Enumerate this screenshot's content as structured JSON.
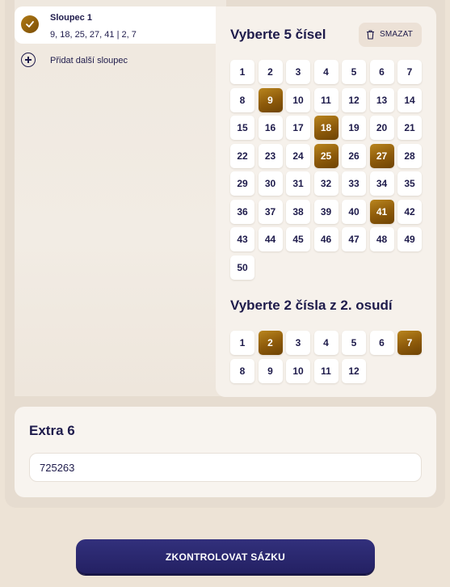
{
  "column": {
    "title": "Sloupec 1",
    "numbers": "9, 18, 25, 27, 41 | 2, 7"
  },
  "add_column_label": "Přidat další sloupec",
  "main_section": {
    "title": "Vyberte 5 čísel",
    "clear_label": "SMAZAT",
    "numbers": [
      1,
      2,
      3,
      4,
      5,
      6,
      7,
      8,
      9,
      10,
      11,
      12,
      13,
      14,
      15,
      16,
      17,
      18,
      19,
      20,
      21,
      22,
      23,
      24,
      25,
      26,
      27,
      28,
      29,
      30,
      31,
      32,
      33,
      34,
      35,
      36,
      37,
      38,
      39,
      40,
      41,
      42,
      43,
      44,
      45,
      46,
      47,
      48,
      49,
      50
    ],
    "selected": [
      9,
      18,
      25,
      27,
      41
    ]
  },
  "second_section": {
    "title": "Vyberte 2 čísla z 2. osudí",
    "numbers": [
      1,
      2,
      3,
      4,
      5,
      6,
      7,
      8,
      9,
      10,
      11,
      12
    ],
    "selected": [
      2,
      7
    ]
  },
  "extra": {
    "title": "Extra 6",
    "value": "725263"
  },
  "submit_label": "ZKONTROLOVAT SÁZKU",
  "colors": {
    "accent_gold": "#8d5a0a",
    "navy": "#1e1b4b",
    "button": "#2a2870"
  },
  "icons": {
    "check": "check-icon",
    "plus": "plus-circle-icon",
    "trash": "trash-icon"
  }
}
